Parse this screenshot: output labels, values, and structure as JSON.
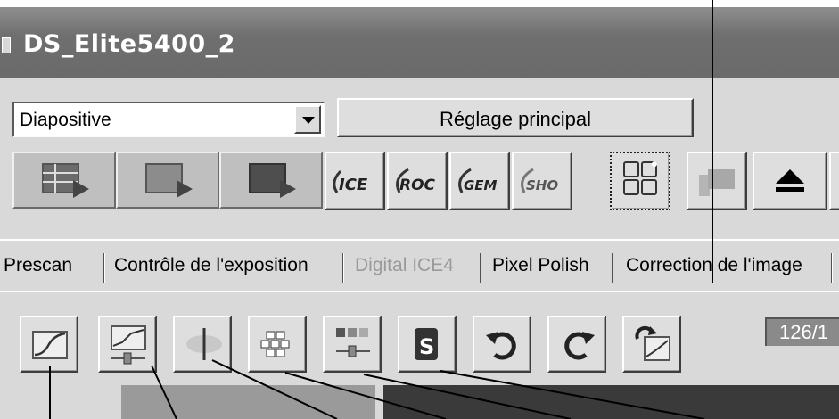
{
  "window": {
    "title": "DS_Elite5400_2"
  },
  "film_type": {
    "selected": "Diapositive"
  },
  "main_setting_button": {
    "label": "Réglage principal"
  },
  "toolbar": {
    "scan_buttons": [
      {
        "icon": "index-scan-icon"
      },
      {
        "icon": "prescan-icon"
      },
      {
        "icon": "scan-icon"
      }
    ],
    "tools": [
      {
        "icon": "ice-icon",
        "text": "ICE"
      },
      {
        "icon": "roc-icon",
        "text": "ROC"
      },
      {
        "icon": "gem-icon",
        "text": "GEM"
      },
      {
        "icon": "sho-icon",
        "text": "SHO"
      },
      {
        "icon": "auto-focus-grid-icon"
      },
      {
        "icon": "flag-icon"
      },
      {
        "icon": "eject-icon"
      }
    ]
  },
  "tabs": [
    {
      "label": "Prescan",
      "enabled": true
    },
    {
      "label": "Contrôle de l'exposition",
      "enabled": true
    },
    {
      "label": "Digital ICE4",
      "enabled": false
    },
    {
      "label": "Pixel Polish",
      "enabled": true
    },
    {
      "label": "Correction de l'image",
      "enabled": true
    }
  ],
  "image_tools": [
    {
      "icon": "tone-curve-icon"
    },
    {
      "icon": "brightness-contrast-slider-icon"
    },
    {
      "icon": "color-balance-icon"
    },
    {
      "icon": "variation-icon"
    },
    {
      "icon": "hue-saturation-slider-icon"
    },
    {
      "icon": "selective-color-icon"
    },
    {
      "icon": "undo-icon"
    },
    {
      "icon": "redo-icon"
    },
    {
      "icon": "reset-icon"
    }
  ],
  "frame_counter": "126/1",
  "colors": {
    "titlebar": "#767676",
    "panel": "#d9d9d9",
    "button_face": "#dedede"
  }
}
